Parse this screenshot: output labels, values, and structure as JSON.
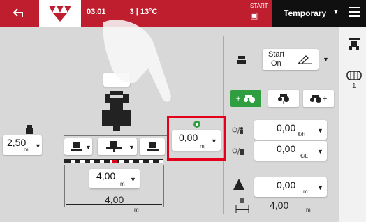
{
  "header": {
    "date_info": "03.01",
    "date_info_tail": "3 | 13°C",
    "start_label": "START",
    "profile_label": "Temporary"
  },
  "start_control": {
    "line1": "Start",
    "line2": "On"
  },
  "mode_buttons": [
    "+",
    "",
    ""
  ],
  "left_width": {
    "value": "2,50",
    "unit": "m"
  },
  "highlighted": {
    "value": "0,00",
    "unit": "m"
  },
  "rate1": {
    "value": "0,00",
    "unit": "€/h"
  },
  "rate2": {
    "value": "0,00",
    "unit": "€/L"
  },
  "area": {
    "value": "0,00",
    "unit": "m"
  },
  "width_display": {
    "value": "4,00",
    "unit": "m"
  },
  "implement_width": {
    "value": "4,00",
    "unit": "m"
  },
  "total_width": {
    "value": "4,00",
    "unit": "m"
  },
  "right_panel_number": "1",
  "colors": {
    "brand_red": "#bf1e2e",
    "highlight_red": "#e3001b",
    "active_green": "#2e9e3e"
  }
}
